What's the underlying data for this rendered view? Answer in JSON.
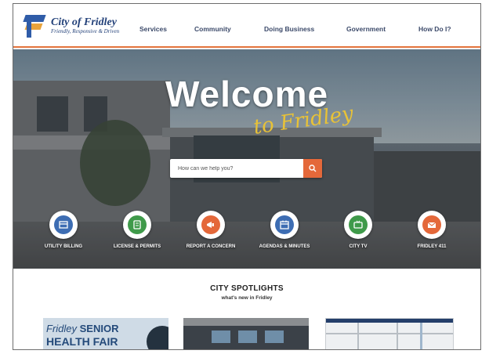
{
  "header": {
    "logo_name": "City of Fridley",
    "logo_tagline": "Friendly, Responsive & Driven",
    "nav": [
      "Services",
      "Community",
      "Doing Business",
      "Government",
      "How Do I?"
    ]
  },
  "hero": {
    "title": "Welcome",
    "subtitle": "to Fridley",
    "search_placeholder": "How can we help you?",
    "quick_links": [
      {
        "label": "Utility Billing",
        "icon": "utility-billing-icon",
        "color": "#3d6db3"
      },
      {
        "label": "License & Permits",
        "icon": "license-permits-icon",
        "color": "#3f9a4a"
      },
      {
        "label": "Report a Concern",
        "icon": "megaphone-icon",
        "color": "#e4683a"
      },
      {
        "label": "Agendas & Minutes",
        "icon": "calendar-icon",
        "color": "#3d6db3"
      },
      {
        "label": "City TV",
        "icon": "tv-icon",
        "color": "#3f9a4a"
      },
      {
        "label": "Fridley 411",
        "icon": "mail-icon",
        "color": "#e4683a"
      }
    ]
  },
  "spotlights": {
    "title": "CITY SPOTLIGHTS",
    "subtitle": "what's new in Fridley",
    "card1_line1_a": "Fridley",
    "card1_line1_b": "SENIOR",
    "card1_line2": "HEALTH FAIR"
  },
  "colors": {
    "accent": "#e4683a",
    "navy": "#24427a",
    "gold": "#e8c237"
  }
}
